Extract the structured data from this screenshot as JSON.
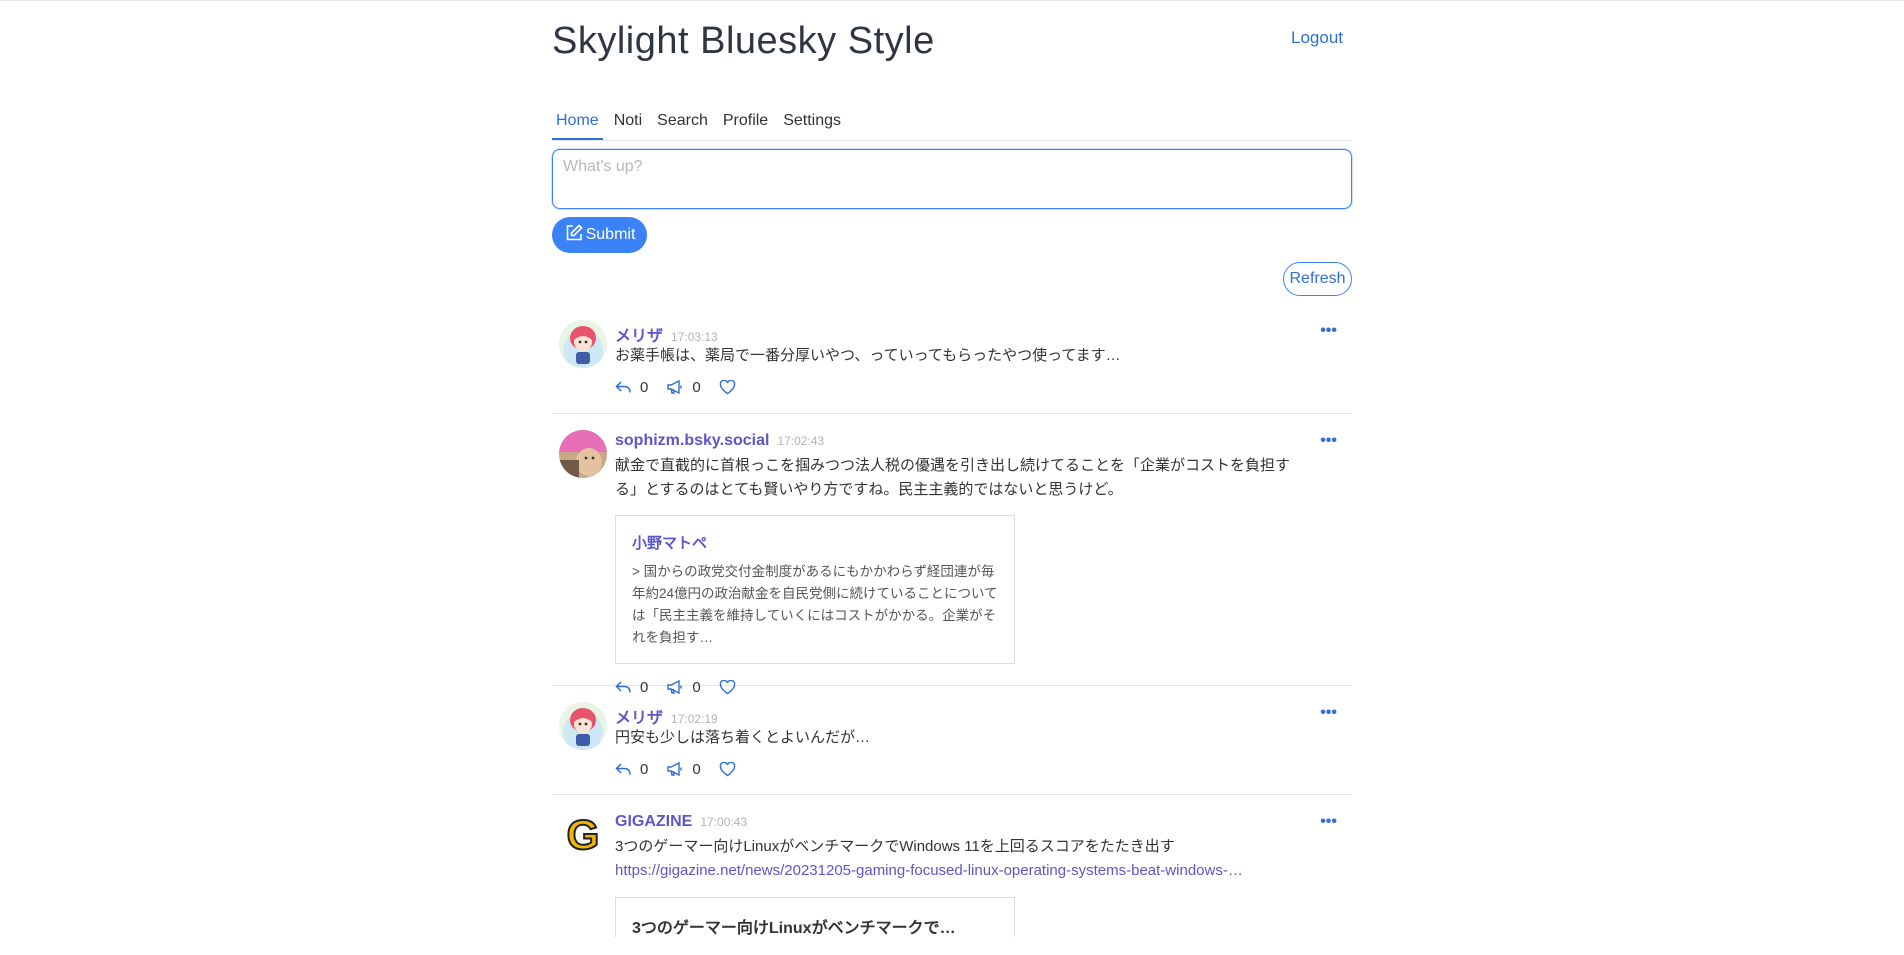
{
  "app": {
    "title": "Skylight Bluesky Style",
    "logout_label": "Logout"
  },
  "tabs": [
    {
      "label": "Home",
      "active": true
    },
    {
      "label": "Noti",
      "active": false
    },
    {
      "label": "Search",
      "active": false
    },
    {
      "label": "Profile",
      "active": false
    },
    {
      "label": "Settings",
      "active": false
    }
  ],
  "compose": {
    "placeholder": "What's up?",
    "value": "",
    "submit_label": "Submit",
    "submit_icon": "edit-icon"
  },
  "refresh_label": "Refresh",
  "colors": {
    "accent": "#3b82f6",
    "author": "#5b57c9",
    "muted": "#b0b4ba"
  },
  "posts": [
    {
      "author": "メリザ",
      "time": "17:03:13",
      "text": "お薬手帳は、薬局で一番分厚いやつ、っていってもらったやつ使ってます…",
      "avatar": "anime-girl-avatar",
      "replies": "0",
      "reposts": "0"
    },
    {
      "author": "sophizm.bsky.social",
      "time": "17:02:43",
      "text": "献金で直截的に首根っこを掴みつつ法人税の優遇を引き出し続けてることを「企業がコストを負担する」とするのはとても賢いやり方ですね。民主主義的ではないと思うけど。",
      "avatar": "photo-avatar",
      "quote": {
        "author": "小野マトペ",
        "text": "> 国からの政党交付金制度があるにもかかわらず経団連が毎年約24億円の政治献金を自民党側に続けていることについては「民主主義を維持していくにはコストがかかる。企業がそれを負担す…"
      },
      "replies": "0",
      "reposts": "0"
    },
    {
      "author": "メリザ",
      "time": "17:02:19",
      "text": "円安も少しは落ち着くとよいんだが…",
      "avatar": "anime-girl-avatar",
      "replies": "0",
      "reposts": "0"
    },
    {
      "author": "GIGAZINE",
      "time": "17:00:43",
      "text": "3つのゲーマー向けLinuxがベンチマークでWindows 11を上回るスコアをたたき出す",
      "link": "https://gigazine.net/news/20231205-gaming-focused-linux-operating-systems-beat-windows-…",
      "avatar": "gigazine-logo-avatar",
      "card_title": "3つのゲーマー向けLinuxがベンチマークで…"
    }
  ]
}
